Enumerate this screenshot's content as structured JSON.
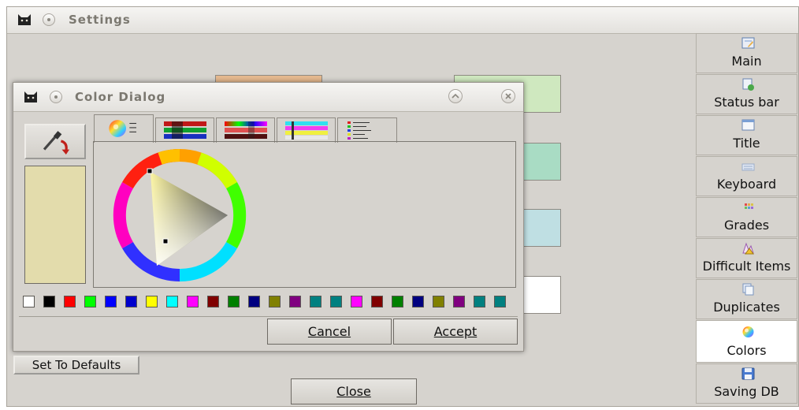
{
  "settings": {
    "title": "Settings",
    "sidebar": [
      {
        "label": "Main",
        "icon": "main-settings-icon",
        "active": false
      },
      {
        "label": "Status bar",
        "icon": "status-bar-icon",
        "active": false
      },
      {
        "label": "Title",
        "icon": "title-window-icon",
        "active": false
      },
      {
        "label": "Keyboard",
        "icon": "keyboard-icon",
        "active": false
      },
      {
        "label": "Grades",
        "icon": "grades-icon",
        "active": false
      },
      {
        "label": "Difficult Items",
        "icon": "difficult-items-icon",
        "active": false
      },
      {
        "label": "Duplicates",
        "icon": "duplicates-icon",
        "active": false
      },
      {
        "label": "Colors",
        "icon": "colors-icon",
        "active": true
      },
      {
        "label": "Saving DB",
        "icon": "floppy-disk-icon",
        "active": false
      }
    ],
    "swatch_colors": [
      "#e6b98f",
      "#cfe8bf",
      "#a9dcc4",
      "#bfdfe3",
      "#ffffff"
    ],
    "set_defaults_label": "Set To Defaults",
    "close_label": "Close"
  },
  "dialog": {
    "title": "Color Dialog",
    "tabs": [
      "color-wheel",
      "rgb-sliders",
      "hsv-sliders",
      "cmyk-sliders",
      "named-list"
    ],
    "preview_color": "#e3dcac",
    "palette": [
      "#ffffff",
      "#000000",
      "#ff0000",
      "#00ff00",
      "#0000ff",
      "#0000cc",
      "#ffff00",
      "#00ffff",
      "#ff00ff",
      "#800000",
      "#008000",
      "#000080",
      "#808000",
      "#800080",
      "#008080",
      "#008080",
      "#ff00ff",
      "#800000",
      "#008000",
      "#000080",
      "#808000",
      "#800080",
      "#008080",
      "#008080"
    ],
    "cancel_label": "Cancel",
    "accept_label": "Accept"
  }
}
